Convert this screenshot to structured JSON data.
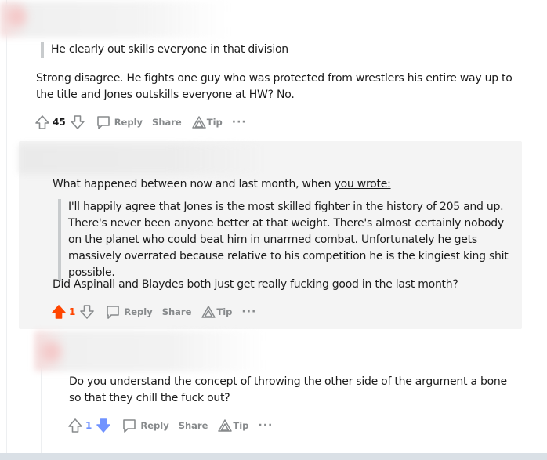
{
  "comments": [
    {
      "quote": "He clearly out skills everyone in that division",
      "body": "Strong disagree. He fights one guy who was protected from wrestlers his entire way up to the title and Jones outskills everyone at HW? No.",
      "votes": "45",
      "vote_state": "none"
    },
    {
      "intro": "What happened between now and last month, when ",
      "link_text": "you wrote:",
      "quote": "I'll happily agree that Jones is the most skilled fighter in the history of 205 and up. There's never been anyone better at that weight. There's almost certainly nobody on the planet who could beat him in unarmed combat. Unfortunately he gets massively overrated because relative to his competition he is the kingiest king shit possible.",
      "body": "Did Aspinall and Blaydes both just get really fucking good in the last month?",
      "votes": "1",
      "vote_state": "up"
    },
    {
      "body": "Do you understand the concept of throwing the other side of the argument a bone so that they chill the fuck out?",
      "votes": "1",
      "vote_state": "down"
    }
  ],
  "actions": {
    "reply": "Reply",
    "share": "Share",
    "tip": "Tip",
    "more": "···"
  },
  "colors": {
    "upvote": "#ff4500",
    "downvote": "#7193ff",
    "muted": "#878a8c"
  }
}
